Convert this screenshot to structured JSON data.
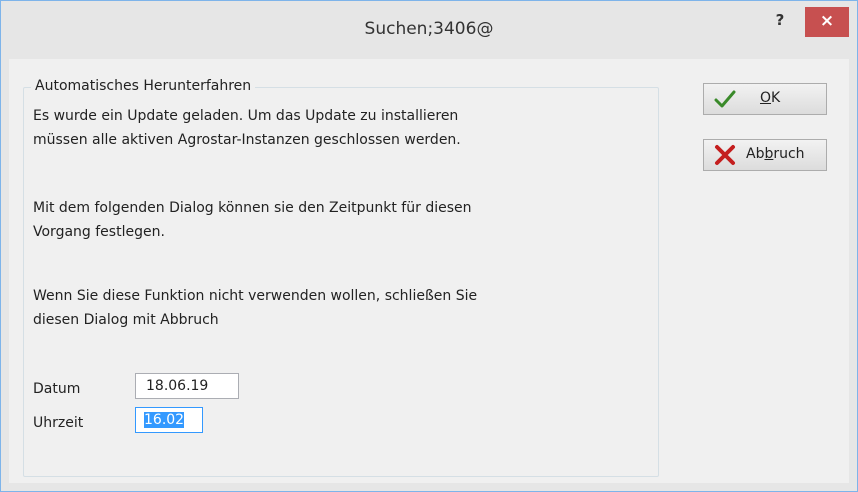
{
  "window": {
    "title": "Suchen;3406@",
    "help_label": "?",
    "close_label": "×"
  },
  "group": {
    "title": "Automatisches Herunterfahren"
  },
  "paragraphs": {
    "p1_line1": "Es wurde ein Update geladen. Um das Update zu installieren",
    "p1_line2": "müssen alle aktiven Agrostar-Instanzen geschlossen werden.",
    "p2_line1": "Mit dem folgenden Dialog können sie den Zeitpunkt für diesen",
    "p2_line2": "Vorgang festlegen.",
    "p3_line1": "Wenn Sie diese Funktion nicht verwenden wollen, schließen Sie",
    "p3_line2": "diesen Dialog mit Abbruch"
  },
  "fields": {
    "date_label": "Datum",
    "date_value": "18.06.19",
    "time_label": "Uhrzeit",
    "time_value": "16.02"
  },
  "buttons": {
    "ok_mnemonic": "O",
    "ok_rest": "K",
    "cancel_pre": "Ab",
    "cancel_mnemonic": "b",
    "cancel_rest": "ruch"
  },
  "icons": {
    "ok": "checkmark-icon",
    "cancel": "red-x-icon"
  },
  "colors": {
    "close_button": "#c75050",
    "selection": "#3399ff",
    "check": "#3a8a2a",
    "x": "#c41e1e"
  }
}
